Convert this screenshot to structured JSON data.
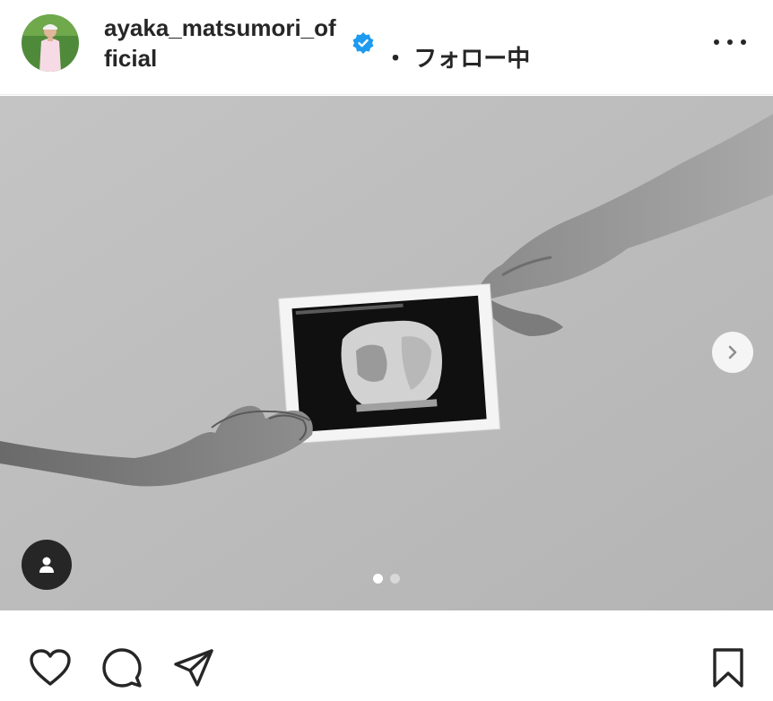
{
  "header": {
    "username": "ayaka_matsumori_official",
    "follow_status": "・ フォロー中",
    "verified_color": "#1d9bf0"
  },
  "media": {
    "carousel_total": 2,
    "carousel_active": 1
  },
  "icons": {
    "more": "more-options-icon",
    "verified": "verified-badge-icon",
    "next": "chevron-right-icon",
    "tag": "user-tag-icon",
    "like": "heart-icon",
    "comment": "comment-icon",
    "share": "share-icon",
    "save": "bookmark-icon"
  }
}
